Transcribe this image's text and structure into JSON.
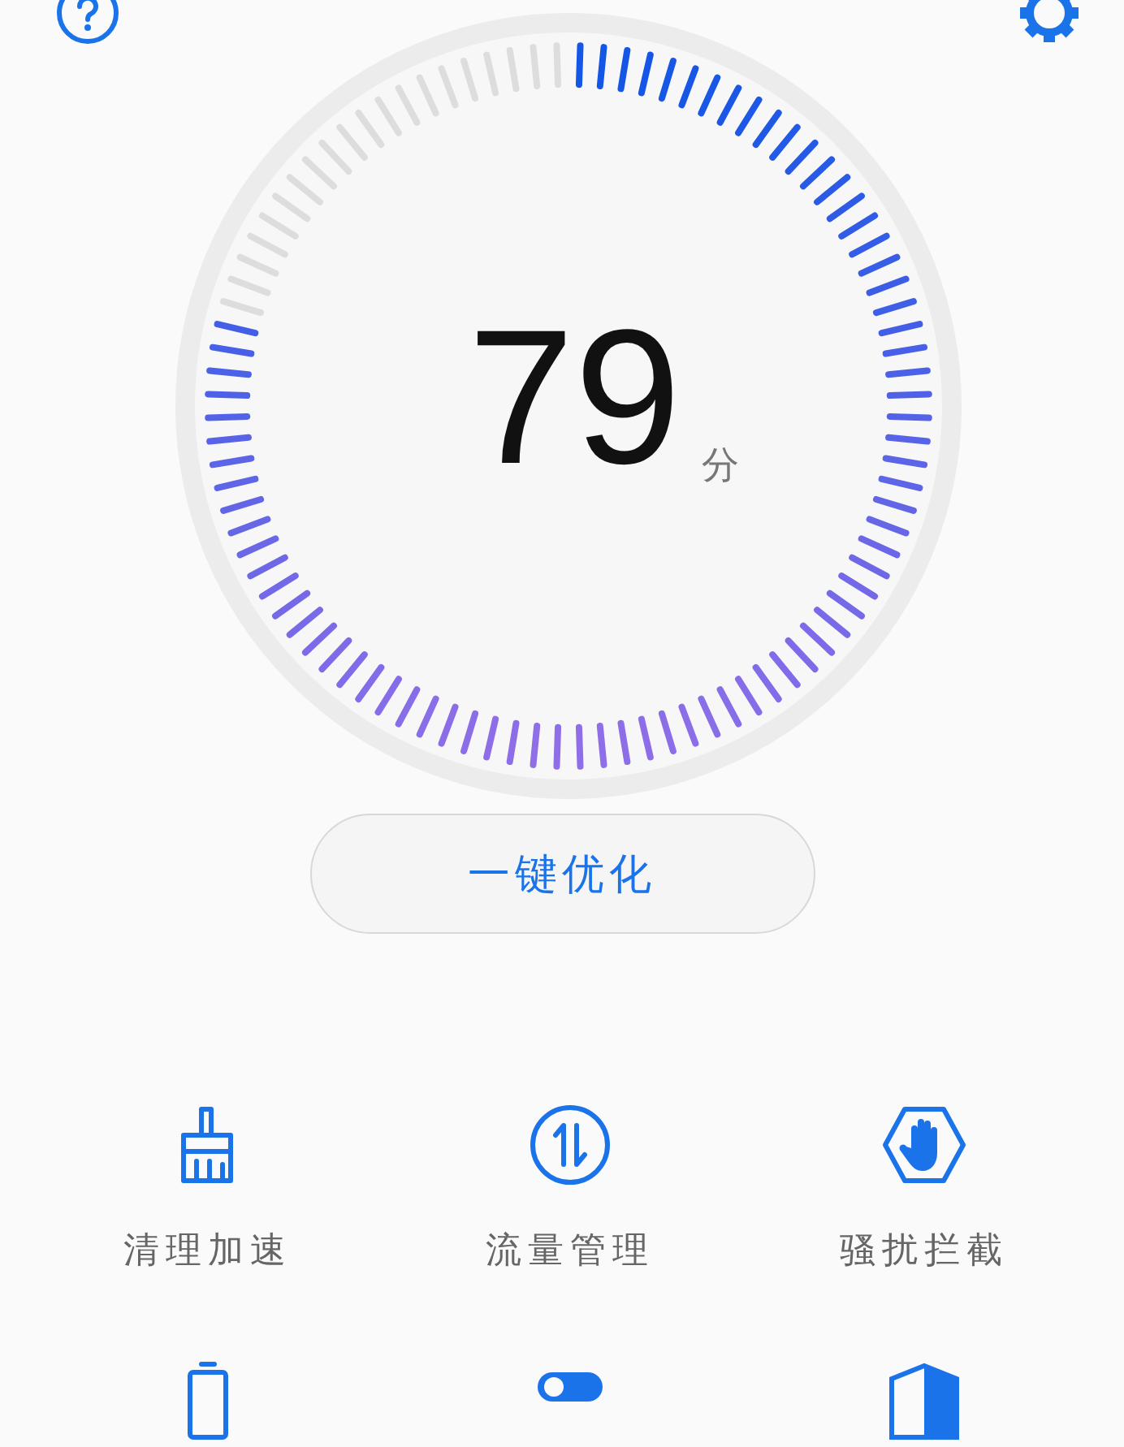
{
  "score": {
    "value": "79",
    "unit": "分"
  },
  "optimize_button": {
    "label": "一键优化"
  },
  "features": [
    {
      "kind": "cleanup",
      "label": "清理加速"
    },
    {
      "kind": "data",
      "label": "流量管理"
    },
    {
      "kind": "block",
      "label": "骚扰拦截"
    },
    {
      "kind": "battery"
    },
    {
      "kind": "permissions"
    },
    {
      "kind": "security"
    }
  ]
}
